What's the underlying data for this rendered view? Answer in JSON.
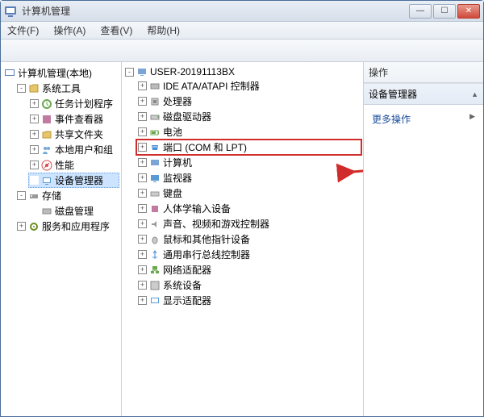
{
  "window": {
    "title": "计算机管理"
  },
  "menubar": {
    "file": "文件(F)",
    "action": "操作(A)",
    "view": "查看(V)",
    "help": "帮助(H)"
  },
  "left_tree": {
    "root": "计算机管理(本地)",
    "system_tools": "系统工具",
    "task_scheduler": "任务计划程序",
    "event_viewer": "事件查看器",
    "shared_folders": "共享文件夹",
    "local_users": "本地用户和组",
    "performance": "性能",
    "device_manager": "设备管理器",
    "storage": "存储",
    "disk_management": "磁盘管理",
    "services_apps": "服务和应用程序"
  },
  "mid_tree": {
    "root": "USER-20191113BX",
    "ide": "IDE ATA/ATAPI 控制器",
    "processor": "处理器",
    "disk_drive": "磁盘驱动器",
    "battery": "电池",
    "ports": "端口 (COM 和 LPT)",
    "computer": "计算机",
    "monitor": "监视器",
    "keyboard": "键盘",
    "hid": "人体学输入设备",
    "sound": "声音、视频和游戏控制器",
    "mouse": "鼠标和其他指针设备",
    "usb": "通用串行总线控制器",
    "network": "网络适配器",
    "system_devices": "系统设备",
    "display": "显示适配器"
  },
  "actions": {
    "header": "操作",
    "section": "设备管理器",
    "more": "更多操作"
  },
  "icons": {
    "mgmt": "#5a7fb8",
    "folder": "#e8c56a",
    "sched": "#6aa84f",
    "event": "#c27ba0",
    "share": "#e8c56a",
    "users": "#6fa8dc",
    "perf": "#d94c4c",
    "device": "#5a9ad4",
    "storage": "#888",
    "disk": "#999",
    "services": "#6b8e23",
    "pc": "#7aa3d6",
    "ide": "#888",
    "cpu": "#888",
    "hdd": "#888",
    "batt": "#6aa84f",
    "port": "#4a90d9",
    "monitor": "#5a9ad4",
    "kb": "#999",
    "hid": "#c27ba0",
    "sound": "#999",
    "mouse": "#888",
    "usb": "#4a90d9",
    "net": "#6aa84f",
    "sys": "#888",
    "disp": "#5a9ad4"
  },
  "annotation_color": "#d12c2c"
}
